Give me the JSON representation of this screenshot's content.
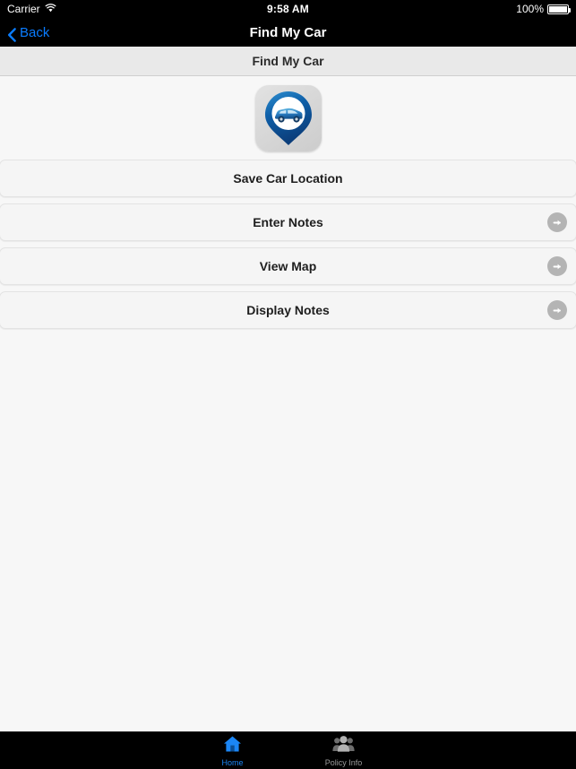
{
  "status_bar": {
    "carrier": "Carrier",
    "wifi_icon": "wifi-icon",
    "time": "9:58 AM",
    "battery_percent": "100%",
    "battery_icon": "battery-full-icon"
  },
  "nav_bar": {
    "back_label": "Back",
    "back_icon": "chevron-left-icon",
    "title": "Find My Car"
  },
  "section_header": {
    "title": "Find My Car"
  },
  "logo": {
    "icon_name": "find-my-car-app-icon",
    "description": "map-pin-with-car-icon"
  },
  "rows": [
    {
      "label": "Save Car Location",
      "has_arrow": false,
      "arrow_icon": ""
    },
    {
      "label": "Enter Notes",
      "has_arrow": true,
      "arrow_icon": "arrow-right-circle-icon"
    },
    {
      "label": "View Map",
      "has_arrow": true,
      "arrow_icon": "arrow-right-circle-icon"
    },
    {
      "label": "Display Notes",
      "has_arrow": true,
      "arrow_icon": "arrow-right-circle-icon"
    }
  ],
  "tab_bar": {
    "tabs": [
      {
        "label": "Home",
        "icon": "home-icon",
        "active": true
      },
      {
        "label": "Policy Info",
        "icon": "people-group-icon",
        "active": false
      }
    ]
  },
  "colors": {
    "accent_blue": "#0a7cff",
    "tab_active_blue": "#1b86f5",
    "tab_inactive_gray": "#9a9a9a",
    "nav_background": "#000000",
    "band_background": "#e9e9e9",
    "page_background": "#f7f7f7",
    "row_background": "#f5f5f5",
    "arrow_circle_gray": "#b4b4b4"
  }
}
